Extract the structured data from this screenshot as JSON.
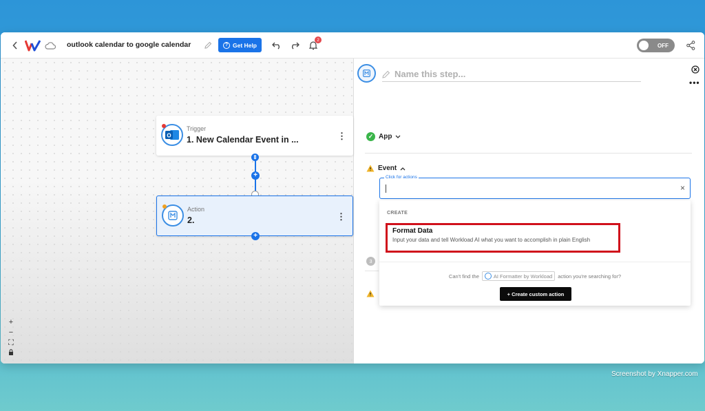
{
  "topbar": {
    "workflow_title": "outlook calendar to google calendar",
    "help_label": "Get Help",
    "notification_count": "2",
    "toggle_label": "OFF",
    "icons": [
      "back-icon",
      "workload-logo",
      "cloud-icon",
      "pencil-icon",
      "question-icon",
      "undo-icon",
      "redo-icon",
      "bell-icon",
      "share-icon"
    ]
  },
  "canvas": {
    "trigger": {
      "kind": "Trigger",
      "name": "1. New Calendar Event in ...",
      "app_icon": "outlook-icon"
    },
    "action": {
      "kind": "Action",
      "name": "2.",
      "app_icon": "ai-formatter-icon"
    },
    "zoom_tools": [
      "+",
      "−",
      "⛶",
      "🔒"
    ]
  },
  "panel": {
    "step_name_placeholder": "Name this step...",
    "app_label": "App",
    "event_label": "Event",
    "step3_number": "3",
    "event_field": {
      "floating_label": "Click for actions",
      "value": ""
    },
    "dropdown": {
      "section": "CREATE",
      "options": [
        {
          "title": "Format Data",
          "description": "Input your data and tell Workload AI what you want to accomplish in plain English"
        }
      ],
      "hint_before": "Can't find the",
      "hint_chip": "AI Formatter by Workload",
      "hint_after": "action you're searching for?",
      "custom_button": "+ Create custom action"
    }
  },
  "watermark": "Screenshot by Xnapper.com",
  "colors": {
    "accent": "#1a73e8",
    "highlight": "#d0101b",
    "success": "#3ab54a",
    "warning": "#f0b429"
  }
}
